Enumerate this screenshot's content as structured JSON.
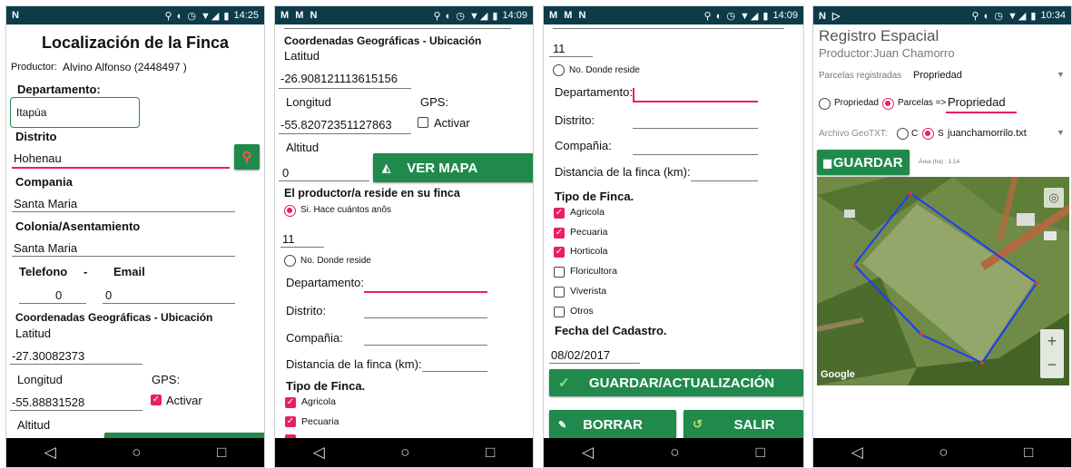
{
  "status_bars": [
    {
      "left": "N",
      "time": "14:25"
    },
    {
      "left": "M M N",
      "time": "14:09"
    },
    {
      "left": "M M N",
      "time": "14:09"
    },
    {
      "left": "N ▷",
      "time": "10:34"
    }
  ],
  "nav_glyphs": {
    "back": "◁",
    "home": "○",
    "recent": "□"
  },
  "screen1": {
    "title": "Localización de la Finca",
    "productor_label": "Productor:",
    "productor_value": "Alvino Alfonso  (2448497 )",
    "departamento_label": "Departamento:",
    "departamento_value": "Itapúa",
    "distrito_label": "Distrito",
    "distrito_value": "Hohenau",
    "compania_label": "Compania",
    "compania_value": "Santa Maria",
    "colonia_label": "Colonia/Asentamiento",
    "colonia_value": "Santa Maria",
    "telefono_label": "Telefono",
    "dash": "-",
    "email_label": "Email",
    "telefono_value": "0",
    "email_value": "0",
    "coords_title": "Coordenadas Geográficas - Ubicación",
    "latitud_label": "Latitud",
    "latitud_value": "-27.30082373",
    "longitud_label": "Longitud",
    "longitud_value": "-55.88831528",
    "gps_label": "GPS:",
    "activar_label": "Activar",
    "altitud_label": "Altitud"
  },
  "screen2": {
    "coords_title": "Coordenadas Geográficas - Ubicación",
    "latitud_label": "Latitud",
    "latitud_value": "-26.908121113615156",
    "longitud_label": "Longitud",
    "gps_label": "GPS:",
    "longitud_value": "-55.82072351127863",
    "activar_label": "Activar",
    "altitud_label": "Altitud",
    "altitud_value": "0",
    "ver_mapa": "VER MAPA",
    "reside_question": "El productor/a reside en su finca",
    "si_label": "Si.  Hace cuántos anôs",
    "anos_value": "11",
    "no_label": "No.  Donde reside",
    "departamento_label": "Departamento:",
    "distrito_label": "Distrito:",
    "compania_label": "Compañia:",
    "distancia_label": "Distancia de la finca (km):",
    "tipo_finca_label": "Tipo de Finca.",
    "tipos": [
      "Agricola",
      "Pecuaria"
    ]
  },
  "screen3": {
    "anos_value": "11",
    "no_label": "No.  Donde reside",
    "departamento_label": "Departamento:",
    "distrito_label": "Distrito:",
    "compania_label": "Compañia:",
    "distancia_label": "Distancia de la finca (km):",
    "tipo_finca_label": "Tipo de Finca.",
    "tipos": [
      {
        "label": "Agricola",
        "checked": true
      },
      {
        "label": "Pecuaria",
        "checked": true
      },
      {
        "label": "Horticola",
        "checked": true
      },
      {
        "label": "Floricultora",
        "checked": false
      },
      {
        "label": "Viverista",
        "checked": false
      },
      {
        "label": "Otros",
        "checked": false
      }
    ],
    "fecha_label": "Fecha del Cadastro.",
    "fecha_value": "08/02/2017",
    "guardar_actualizacion": "GUARDAR/ACTUALIZACIÓN",
    "borrar": "BORRAR",
    "salir": "SALIR"
  },
  "screen4": {
    "title": "Registro Espacial",
    "productor": "Productor:Juan Chamorro",
    "parcelas_label": "Parcelas registradas",
    "parcelas_value": "Propriedad",
    "opt_propiedad": "Propriedad",
    "opt_parcelas": "Parcelas =>",
    "parcela_input": "Propriedad",
    "archivo_label": "Archivo GeoTXT:",
    "opt_c": "C",
    "opt_s": "S",
    "archivo_value": "juanchamorrilo.txt",
    "guardar": "GUARDAR",
    "area_label": "Área (ha) : 1.14",
    "zoom_in": "+",
    "zoom_out": "−",
    "google_label": "Google"
  },
  "colors": {
    "accent": "#e91e63",
    "button_green": "#1f8a4c",
    "status_bar": "#0d3b4a",
    "polygon": "#1e3cff"
  }
}
